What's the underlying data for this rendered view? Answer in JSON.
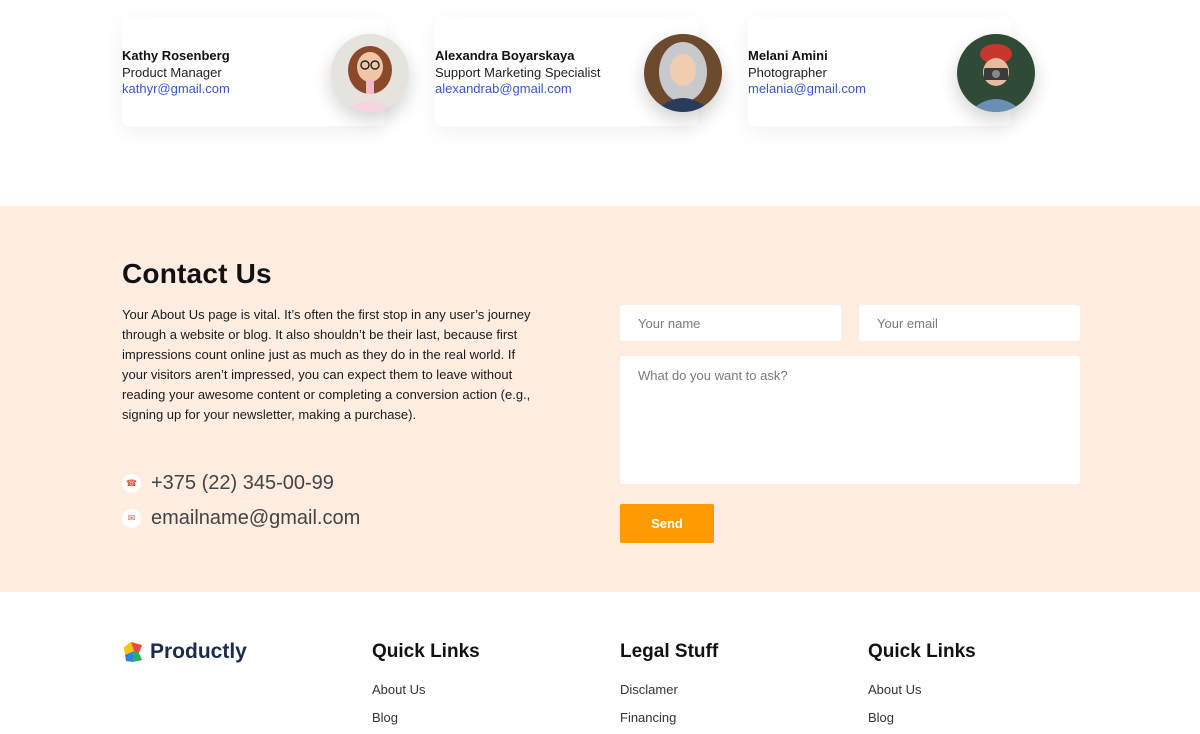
{
  "team": [
    {
      "name": "Kathy Rosenberg",
      "role": "Product Manager",
      "email": "kathyr@gmail.com"
    },
    {
      "name": "Alexandra Boyarskaya",
      "role": "Support Marketing Specialist",
      "email": "alexandrab@gmail.com"
    },
    {
      "name": "Melani Amini",
      "role": "Photographer",
      "email": "melania@gmail.com"
    }
  ],
  "contact": {
    "title": "Contact Us",
    "description": "Your About Us page is vital. It’s often the first stop in any user’s journey through a website or blog. It also shouldn’t be their last, because first impressions count online just as much as they do in the real world. If your visitors aren’t impressed, you can expect them to leave without reading your awesome content or completing a conversion action (e.g., signing up for your newsletter, making a purchase).",
    "phone": "+375 (22) 345-00-99",
    "email": "emailname@gmail.com",
    "phone_icon": "phone-icon",
    "email_icon": "envelope-icon",
    "form": {
      "name_placeholder": "Your name",
      "email_placeholder": "Your email",
      "message_placeholder": "What do you want to ask?",
      "send_label": "Send"
    },
    "accent_color": "#ff9b00",
    "background_color": "#ffede2"
  },
  "footer": {
    "logo_text": "Productly",
    "columns": [
      {
        "title": "Quick Links",
        "links": [
          "About Us",
          "Blog"
        ]
      },
      {
        "title": "Legal Stuff",
        "links": [
          "Disclamer",
          "Financing"
        ]
      },
      {
        "title": "Quick Links",
        "links": [
          "About Us",
          "Blog"
        ]
      }
    ]
  }
}
